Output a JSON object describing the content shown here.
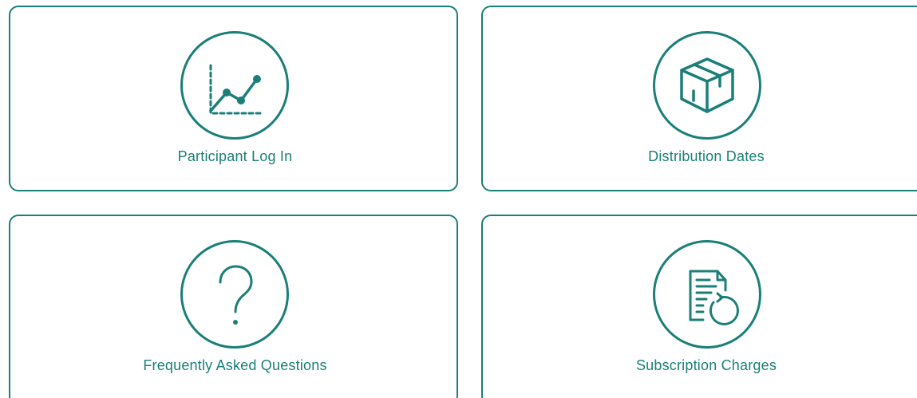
{
  "accent_color": "#1a7f78",
  "cards": [
    {
      "label": "Participant Log In",
      "icon": "line-chart-icon"
    },
    {
      "label": "Distribution Dates",
      "icon": "box-icon"
    },
    {
      "label": "Frequently Asked Questions",
      "icon": "question-mark-icon"
    },
    {
      "label": "Subscription Charges",
      "icon": "document-refresh-icon"
    }
  ]
}
